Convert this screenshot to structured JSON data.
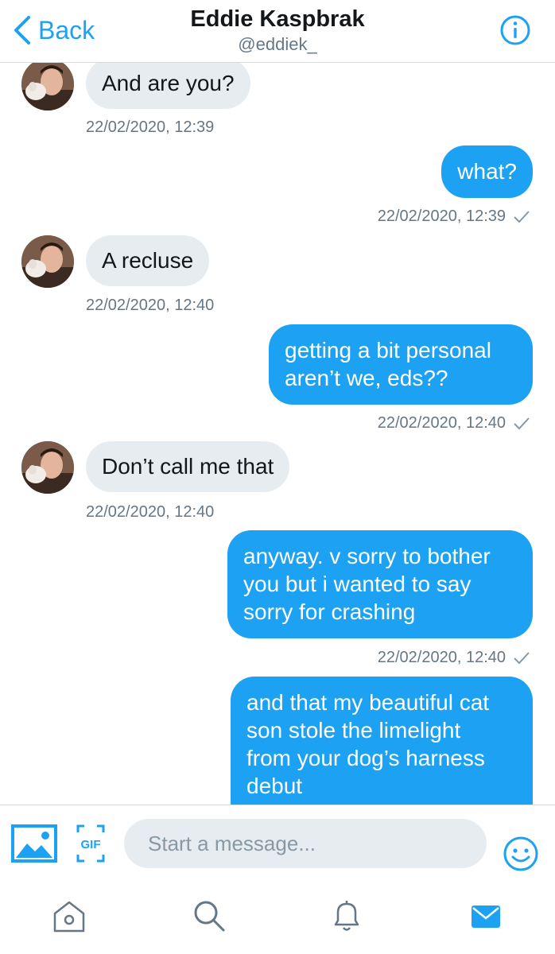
{
  "header": {
    "back_label": "Back",
    "title": "Eddie Kaspbrak",
    "handle": "@eddiek_"
  },
  "messages": [
    {
      "direction": "in",
      "text": "And are you?",
      "timestamp": "22/02/2020, 12:39"
    },
    {
      "direction": "out",
      "text": "what?",
      "timestamp": "22/02/2020, 12:39",
      "status": "sent"
    },
    {
      "direction": "in",
      "text": "A recluse",
      "timestamp": "22/02/2020, 12:40"
    },
    {
      "direction": "out",
      "text": "getting a bit personal\naren’t we, eds??",
      "timestamp": "22/02/2020, 12:40",
      "status": "sent"
    },
    {
      "direction": "in",
      "text": "Don’t call me that",
      "timestamp": "22/02/2020, 12:40"
    },
    {
      "direction": "out",
      "text": "anyway. v sorry to bother\nyou but i wanted to say\nsorry for crashing",
      "timestamp": "22/02/2020, 12:40",
      "status": "sent"
    },
    {
      "direction": "out",
      "text": "and that my beautiful cat\nson stole the limelight\nfrom your dog’s harness\ndebut"
    }
  ],
  "composer": {
    "placeholder": "Start a message...",
    "gif_label": "GIF",
    "icons": [
      "image-icon",
      "gif-icon",
      "emoji-icon"
    ]
  },
  "tabbar": {
    "icons": [
      "home-icon",
      "search-icon",
      "notifications-icon",
      "messages-icon"
    ],
    "active": "messages-icon"
  },
  "colors": {
    "accent": "#1da1f2",
    "incoming_bubble": "#e6ecf0",
    "secondary_text": "#657786",
    "divider": "#d9dcdf"
  }
}
